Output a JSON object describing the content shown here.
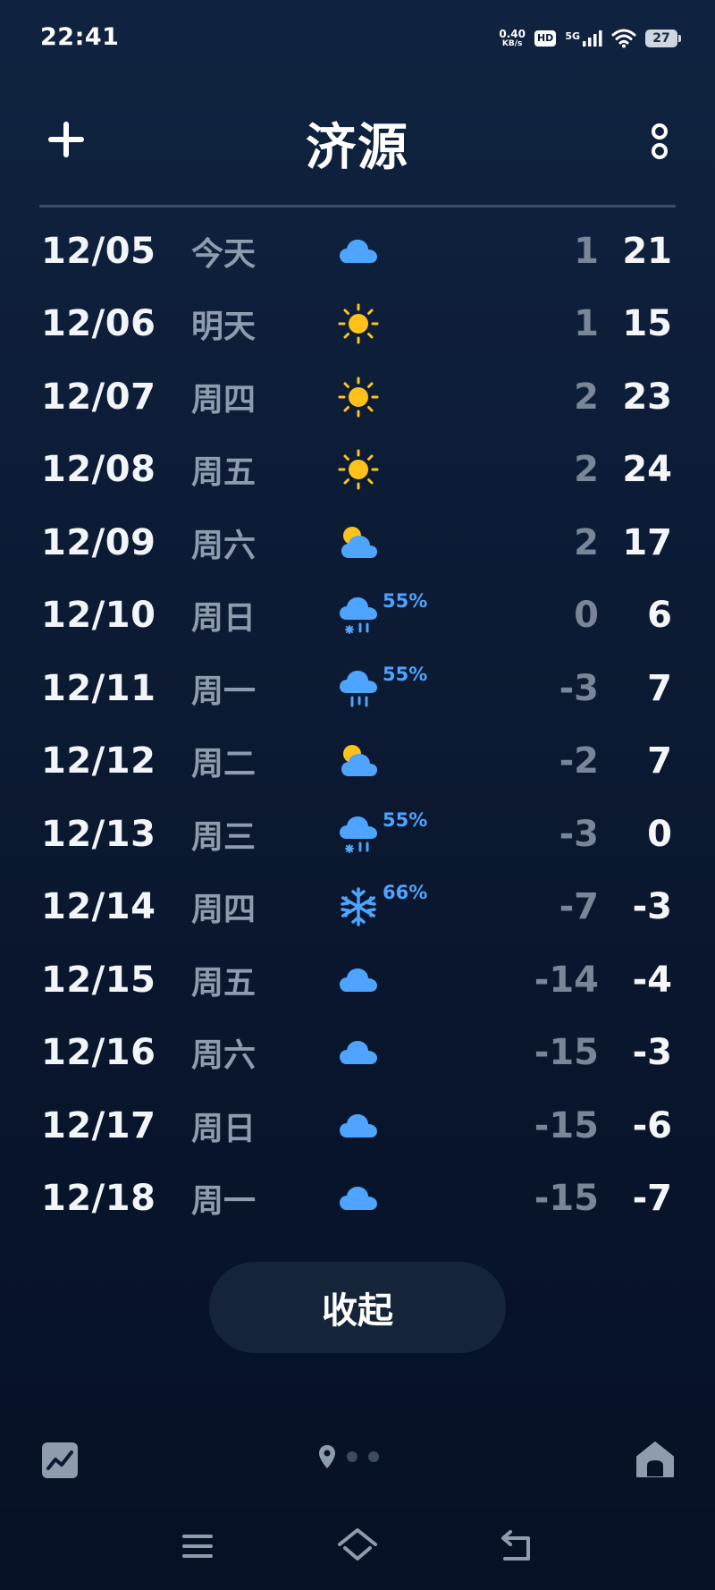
{
  "status_bar": {
    "time": "22:41",
    "net_speed_value": "0.40",
    "net_speed_unit": "KB/s",
    "hd_label": "HD",
    "network_label": "5G",
    "battery_level": "27"
  },
  "header": {
    "city": "济源",
    "add_icon": "plus-icon",
    "more_icon": "more-vertical-icon"
  },
  "forecast": [
    {
      "date": "12/05",
      "weekday": "今天",
      "icon": "cloudy",
      "precip": "",
      "low": "1",
      "high": "21"
    },
    {
      "date": "12/06",
      "weekday": "明天",
      "icon": "sunny",
      "precip": "",
      "low": "1",
      "high": "15"
    },
    {
      "date": "12/07",
      "weekday": "周四",
      "icon": "sunny",
      "precip": "",
      "low": "2",
      "high": "23"
    },
    {
      "date": "12/08",
      "weekday": "周五",
      "icon": "sunny",
      "precip": "",
      "low": "2",
      "high": "24"
    },
    {
      "date": "12/09",
      "weekday": "周六",
      "icon": "partly-cloudy",
      "precip": "",
      "low": "2",
      "high": "17"
    },
    {
      "date": "12/10",
      "weekday": "周日",
      "icon": "sleet",
      "precip": "55%",
      "low": "0",
      "high": "6"
    },
    {
      "date": "12/11",
      "weekday": "周一",
      "icon": "rain",
      "precip": "55%",
      "low": "-3",
      "high": "7"
    },
    {
      "date": "12/12",
      "weekday": "周二",
      "icon": "partly-cloudy",
      "precip": "",
      "low": "-2",
      "high": "7"
    },
    {
      "date": "12/13",
      "weekday": "周三",
      "icon": "sleet",
      "precip": "55%",
      "low": "-3",
      "high": "0"
    },
    {
      "date": "12/14",
      "weekday": "周四",
      "icon": "snow",
      "precip": "66%",
      "low": "-7",
      "high": "-3"
    },
    {
      "date": "12/15",
      "weekday": "周五",
      "icon": "cloudy",
      "precip": "",
      "low": "-14",
      "high": "-4"
    },
    {
      "date": "12/16",
      "weekday": "周六",
      "icon": "cloudy",
      "precip": "",
      "low": "-15",
      "high": "-3"
    },
    {
      "date": "12/17",
      "weekday": "周日",
      "icon": "cloudy",
      "precip": "",
      "low": "-15",
      "high": "-6"
    },
    {
      "date": "12/18",
      "weekday": "周一",
      "icon": "cloudy",
      "precip": "",
      "low": "-15",
      "high": "-7"
    }
  ],
  "collapse_label": "收起",
  "bottom_bar": {
    "left_icon": "trend-chart-icon",
    "right_icon": "home-icon",
    "location_icon": "location-pin-icon",
    "page_count": 3
  },
  "nav_bar": {
    "icons": [
      "menu-icon",
      "home-outline-icon",
      "back-icon"
    ]
  },
  "colors": {
    "background_top": "#0f2340",
    "background_bottom": "#061126",
    "cloud": "#4ea4ff",
    "sun": "#ffc21a",
    "precip_text": "#4ea4ff",
    "low_temp": "#7a8698",
    "high_temp": "#f4f6f9"
  }
}
